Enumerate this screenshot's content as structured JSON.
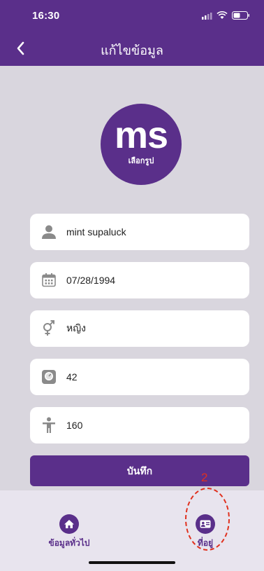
{
  "status_bar": {
    "time": "16:30"
  },
  "header": {
    "title": "แก้ไขข้อมูล"
  },
  "avatar": {
    "initials": "ms",
    "label": "เลือกรูป"
  },
  "fields": {
    "name": "mint supaluck",
    "birthdate": "07/28/1994",
    "gender": "หญิง",
    "weight": "42",
    "height": "160"
  },
  "save_button": {
    "label": "บันทึก"
  },
  "tabs": [
    {
      "label": "ข้อมูลทั่วไป",
      "icon": "home-icon"
    },
    {
      "label": "ที่อยู่",
      "icon": "id-card-icon"
    }
  ],
  "annotation": {
    "number": "2"
  },
  "colors": {
    "primary": "#5a2f8a",
    "background": "#d9d6de",
    "annotation": "#e0301e"
  }
}
